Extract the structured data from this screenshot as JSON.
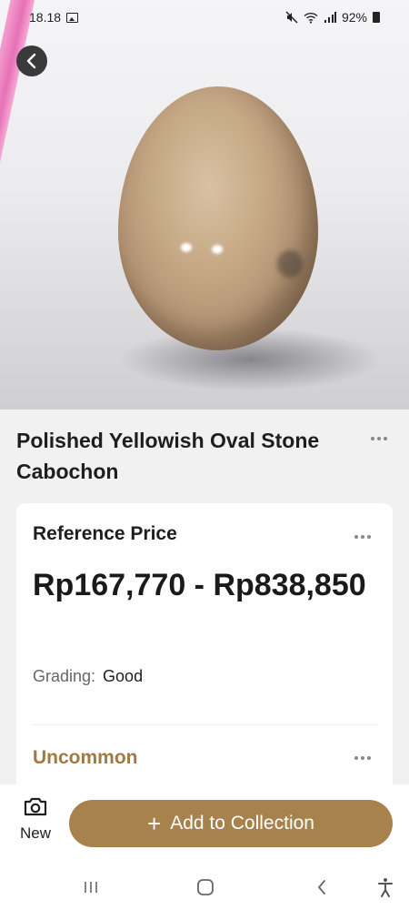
{
  "status_bar": {
    "time": "18.18",
    "battery": "92%"
  },
  "product": {
    "title": "Polished Yellowish Oval Stone Cabochon"
  },
  "price_card": {
    "heading": "Reference Price",
    "price_range": "Rp167,770 - Rp838,850",
    "grading_label": "Grading:",
    "grading_value": "Good",
    "rarity": "Uncommon"
  },
  "actions": {
    "new_label": "New",
    "add_label": "Add to Collection"
  },
  "colors": {
    "accent": "#a7824d",
    "rarity_text": "#a07a44"
  },
  "icons": [
    "back-arrow-icon",
    "more-options-icon",
    "camera-icon",
    "plus-icon",
    "recent-apps-icon",
    "home-icon",
    "back-nav-icon",
    "accessibility-icon"
  ]
}
